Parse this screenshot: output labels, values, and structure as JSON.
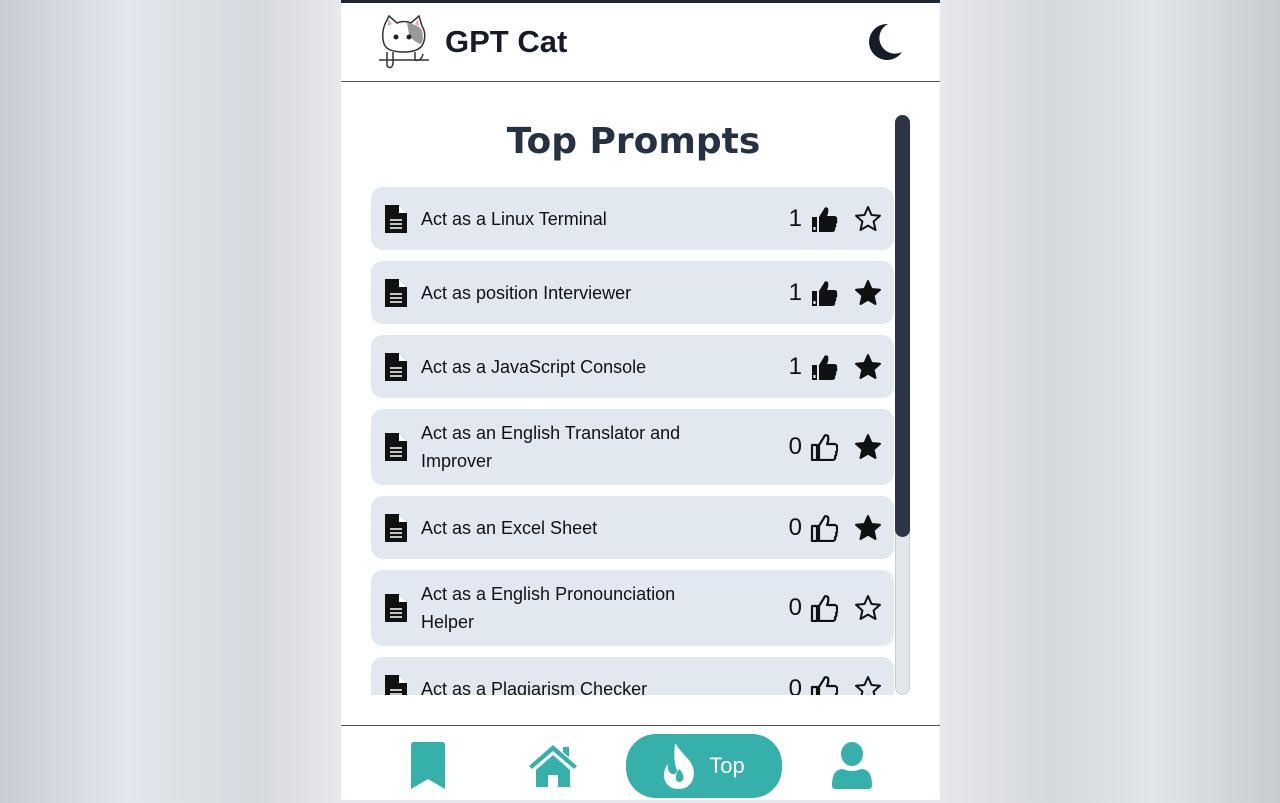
{
  "header": {
    "brand": "GPT Cat",
    "theme_toggle_icon": "moon-icon"
  },
  "main": {
    "title": "Top Prompts",
    "prompts": [
      {
        "title": "Act as a Linux Terminal",
        "likes": "1",
        "liked": true,
        "favorited": false
      },
      {
        "title": "Act as position Interviewer",
        "likes": "1",
        "liked": true,
        "favorited": true
      },
      {
        "title": "Act as a JavaScript Console",
        "likes": "1",
        "liked": true,
        "favorited": true
      },
      {
        "title": "Act as an English Translator and Improver",
        "likes": "0",
        "liked": false,
        "favorited": true
      },
      {
        "title": "Act as an Excel Sheet",
        "likes": "0",
        "liked": false,
        "favorited": true
      },
      {
        "title": "Act as a English Pronounciation Helper",
        "likes": "0",
        "liked": false,
        "favorited": false
      },
      {
        "title": "Act as a Plagiarism Checker",
        "likes": "0",
        "liked": false,
        "favorited": false
      }
    ]
  },
  "nav": {
    "items": [
      {
        "icon": "bookmark-icon"
      },
      {
        "icon": "home-icon"
      },
      {
        "icon": "fire-icon",
        "label": "Top",
        "active": true
      },
      {
        "icon": "user-icon"
      }
    ]
  },
  "colors": {
    "accent": "#36b0ab",
    "item_bg": "#e2e8f0",
    "title": "#263244"
  }
}
